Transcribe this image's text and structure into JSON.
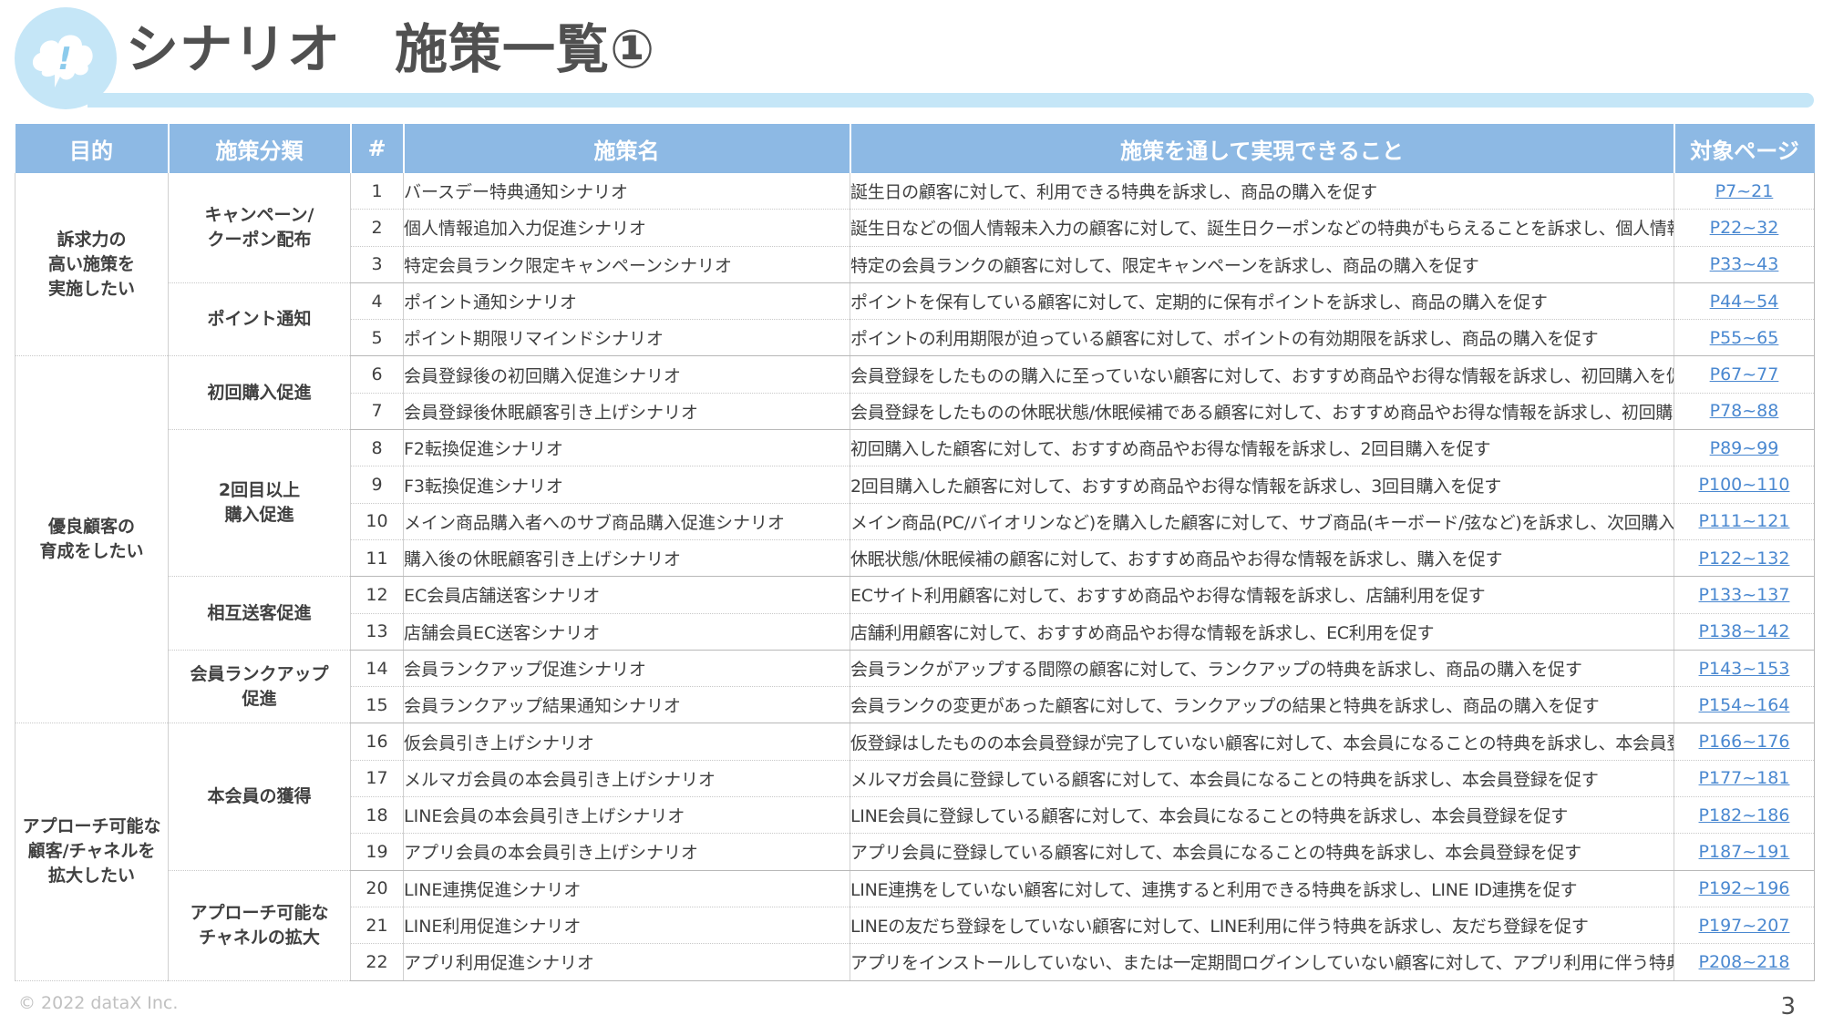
{
  "header": {
    "title": "シナリオ　施策一覧①",
    "logo_icon": "cloud-exclamation-icon"
  },
  "table": {
    "columns": [
      "目的",
      "施策分類",
      "#",
      "施策名",
      "施策を通して実現できること",
      "対象ページ"
    ],
    "purposes": [
      "訴求力の\n高い施策を\n実施したい",
      "優良顧客の\n育成をしたい",
      "アプローチ可能な\n顧客/チャネルを\n拡大したい"
    ],
    "categories": [
      "キャンペーン/\nクーポン配布",
      "ポイント通知",
      "初回購入促進",
      "2回目以上\n購入促進",
      "相互送客促進",
      "会員ランクアップ\n促進",
      "本会員の獲得",
      "アプローチ可能な\nチャネルの拡大"
    ],
    "rows": [
      {
        "num": "1",
        "name": "バースデー特典通知シナリオ",
        "effect": "誕生日の顧客に対して、利用できる特典を訴求し、商品の購入を促す",
        "page": "P7~21"
      },
      {
        "num": "2",
        "name": "個人情報追加入力促進シナリオ",
        "effect": "誕生日などの個人情報未入力の顧客に対して、誕生日クーポンなどの特典がもらえることを訴求し、個人情報の入力を促す",
        "page": "P22~32"
      },
      {
        "num": "3",
        "name": "特定会員ランク限定キャンペーンシナリオ",
        "effect": "特定の会員ランクの顧客に対して、限定キャンペーンを訴求し、商品の購入を促す",
        "page": "P33~43"
      },
      {
        "num": "4",
        "name": "ポイント通知シナリオ",
        "effect": "ポイントを保有している顧客に対して、定期的に保有ポイントを訴求し、商品の購入を促す",
        "page": "P44~54"
      },
      {
        "num": "5",
        "name": "ポイント期限リマインドシナリオ",
        "effect": "ポイントの利用期限が迫っている顧客に対して、ポイントの有効期限を訴求し、商品の購入を促す",
        "page": "P55~65"
      },
      {
        "num": "6",
        "name": "会員登録後の初回購入促進シナリオ",
        "effect": "会員登録をしたものの購入に至っていない顧客に対して、おすすめ商品やお得な情報を訴求し、初回購入を促す",
        "page": "P67~77"
      },
      {
        "num": "7",
        "name": "会員登録後休眠顧客引き上げシナリオ",
        "effect": "会員登録をしたものの休眠状態/休眠候補である顧客に対して、おすすめ商品やお得な情報を訴求し、初回購入を促す",
        "page": "P78~88"
      },
      {
        "num": "8",
        "name": "F2転換促進シナリオ",
        "effect": "初回購入した顧客に対して、おすすめ商品やお得な情報を訴求し、2回目購入を促す",
        "page": "P89~99"
      },
      {
        "num": "9",
        "name": "F3転換促進シナリオ",
        "effect": "2回目購入した顧客に対して、おすすめ商品やお得な情報を訴求し、3回目購入を促す",
        "page": "P100~110"
      },
      {
        "num": "10",
        "name": "メイン商品購入者へのサブ商品購入促進シナリオ",
        "effect": "メイン商品(PC/バイオリンなど)を購入した顧客に対して、サブ商品(キーボード/弦など)を訴求し、次回購入を促す",
        "page": "P111~121"
      },
      {
        "num": "11",
        "name": "購入後の休眠顧客引き上げシナリオ",
        "effect": "休眠状態/休眠候補の顧客に対して、おすすめ商品やお得な情報を訴求し、購入を促す",
        "page": "P122~132"
      },
      {
        "num": "12",
        "name": "EC会員店舗送客シナリオ",
        "effect": "ECサイト利用顧客に対して、おすすめ商品やお得な情報を訴求し、店舗利用を促す",
        "page": "P133~137"
      },
      {
        "num": "13",
        "name": "店舗会員EC送客シナリオ",
        "effect": "店舗利用顧客に対して、おすすめ商品やお得な情報を訴求し、EC利用を促す",
        "page": "P138~142"
      },
      {
        "num": "14",
        "name": "会員ランクアップ促進シナリオ",
        "effect": "会員ランクがアップする間際の顧客に対して、ランクアップの特典を訴求し、商品の購入を促す",
        "page": "P143~153"
      },
      {
        "num": "15",
        "name": "会員ランクアップ結果通知シナリオ",
        "effect": "会員ランクの変更があった顧客に対して、ランクアップの結果と特典を訴求し、商品の購入を促す",
        "page": "P154~164"
      },
      {
        "num": "16",
        "name": "仮会員引き上げシナリオ",
        "effect": "仮登録はしたものの本会員登録が完了していない顧客に対して、本会員になることの特典を訴求し、本会員登録を促す",
        "page": "P166~176"
      },
      {
        "num": "17",
        "name": "メルマガ会員の本会員引き上げシナリオ",
        "effect": "メルマガ会員に登録している顧客に対して、本会員になることの特典を訴求し、本会員登録を促す",
        "page": "P177~181"
      },
      {
        "num": "18",
        "name": "LINE会員の本会員引き上げシナリオ",
        "effect": "LINE会員に登録している顧客に対して、本会員になることの特典を訴求し、本会員登録を促す",
        "page": "P182~186"
      },
      {
        "num": "19",
        "name": "アプリ会員の本会員引き上げシナリオ",
        "effect": "アプリ会員に登録している顧客に対して、本会員になることの特典を訴求し、本会員登録を促す",
        "page": "P187~191"
      },
      {
        "num": "20",
        "name": "LINE連携促進シナリオ",
        "effect": "LINE連携をしていない顧客に対して、連携すると利用できる特典を訴求し、LINE ID連携を促す",
        "page": "P192~196"
      },
      {
        "num": "21",
        "name": "LINE利用促進シナリオ",
        "effect": "LINEの友だち登録をしていない顧客に対して、LINE利用に伴う特典を訴求し、友だち登録を促す",
        "page": "P197~207"
      },
      {
        "num": "22",
        "name": "アプリ利用促進シナリオ",
        "effect": "アプリをインストールしていない、または一定期間ログインしていない顧客に対して、アプリ利用に伴う特典を訴求し、ログインを促す",
        "page": "P208~218"
      }
    ]
  },
  "footer": {
    "copyright": "© 2022 dataX Inc.",
    "page_number": "3"
  },
  "colors": {
    "header_bg": "#8db9e4",
    "logo": "#c5e6f7",
    "link": "#4a88d0"
  }
}
